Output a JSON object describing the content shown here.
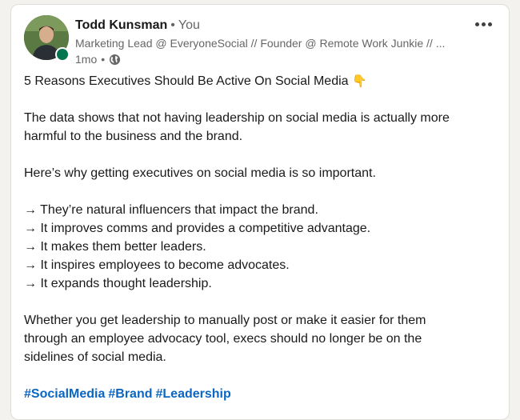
{
  "author": {
    "name": "Todd Kunsman",
    "separator": "•",
    "relation": "You",
    "headline": "Marketing Lead @ EveryoneSocial // Founder @ Remote Work Junkie // ...",
    "time": "1mo",
    "time_separator": "•",
    "visibility_icon": "globe-icon",
    "online_status_color": "#01754f"
  },
  "post": {
    "title": "5 Reasons Executives Should Be Active On Social Media",
    "title_emoji": "👇",
    "para1_line1": "The data shows that not having leadership on social media is actually more",
    "para1_line2": "harmful to the business and the brand.",
    "para2": "Here’s why getting executives on social media is so important.",
    "reasons": [
      "→ They’re natural influencers that impact the brand.",
      "→ It improves comms and provides a competitive advantage.",
      "→ It makes them better leaders.",
      "→ It inspires employees to become advocates.",
      "→ It expands thought leadership."
    ],
    "para3_line1": "Whether you get leadership to manually post or make it easier for them",
    "para3_line2": "through an employee advocacy tool, execs should no longer be on the",
    "para3_line3": "sidelines of social media.",
    "hashtags": [
      "#SocialMedia",
      "#Brand",
      "#Leadership"
    ]
  },
  "colors": {
    "link": "#0a66c2",
    "text": "#191919",
    "muted": "#666666"
  }
}
